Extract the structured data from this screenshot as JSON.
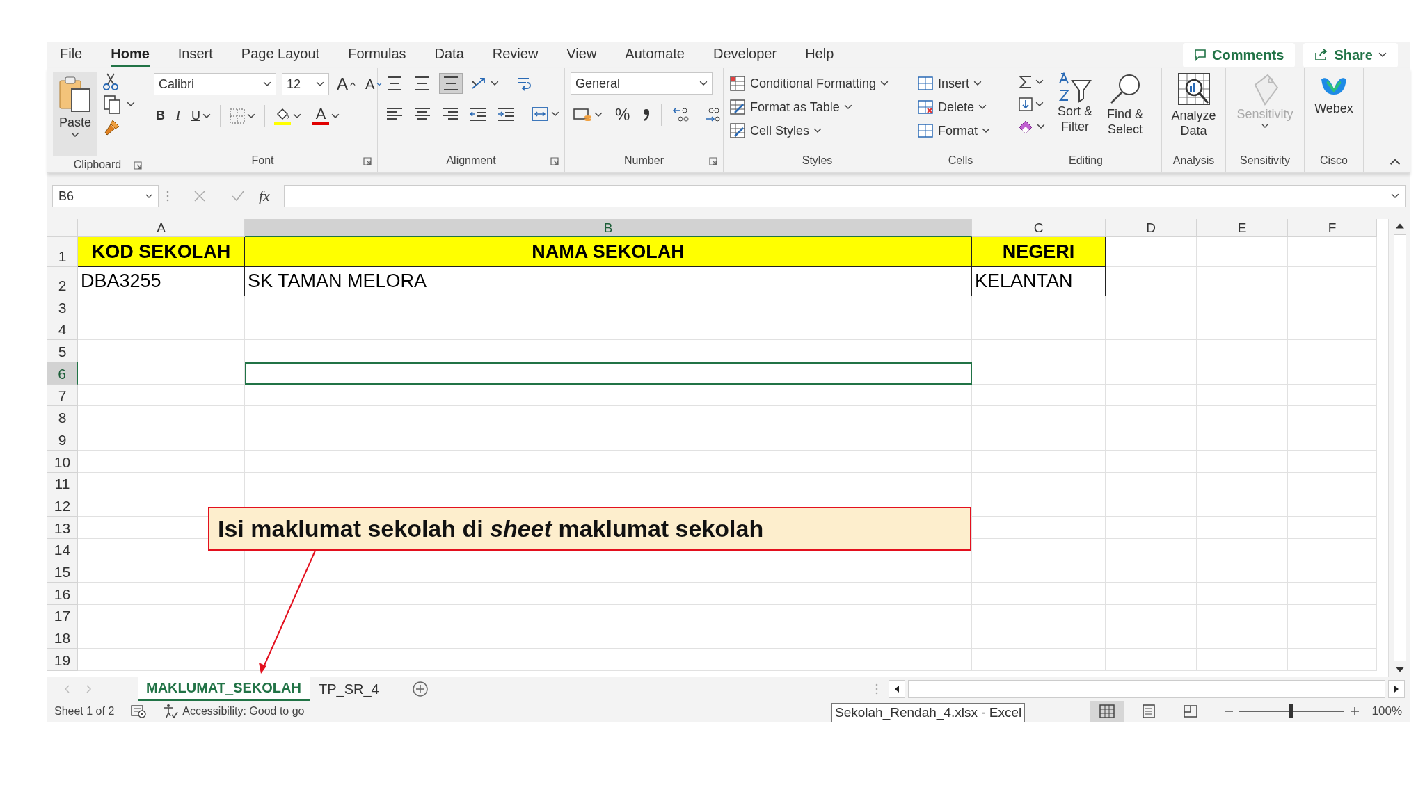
{
  "menu_tabs": [
    {
      "label": "File",
      "selected": false
    },
    {
      "label": "Home",
      "selected": true
    },
    {
      "label": "Insert",
      "selected": false
    },
    {
      "label": "Page Layout",
      "selected": false
    },
    {
      "label": "Formulas",
      "selected": false
    },
    {
      "label": "Data",
      "selected": false
    },
    {
      "label": "Review",
      "selected": false
    },
    {
      "label": "View",
      "selected": false
    },
    {
      "label": "Automate",
      "selected": false
    },
    {
      "label": "Developer",
      "selected": false
    },
    {
      "label": "Help",
      "selected": false
    }
  ],
  "comments_button": "Comments",
  "share_button": "Share",
  "ribbon": {
    "groups": [
      {
        "kind": "clipboard",
        "label": "Clipboard",
        "paste": "Paste"
      },
      {
        "kind": "font",
        "label": "Font",
        "font_name": "Calibri",
        "font_size": "12",
        "grow": "A",
        "shrink": "A",
        "bold": "B",
        "italic": "I",
        "underline": "U",
        "font_color": "A"
      },
      {
        "kind": "alignment",
        "label": "Alignment"
      },
      {
        "kind": "number",
        "label": "Number",
        "format": "General",
        "percent": "%"
      },
      {
        "kind": "styles",
        "label": "Styles",
        "items": [
          "Conditional Formatting",
          "Format as Table",
          "Cell Styles"
        ]
      },
      {
        "kind": "cells",
        "label": "Cells",
        "items": [
          "Insert",
          "Delete",
          "Format"
        ]
      },
      {
        "kind": "editing",
        "label": "Editing",
        "buttons": [
          "Sort & Filter",
          "Find & Select"
        ]
      },
      {
        "kind": "analysis",
        "label": "Analysis",
        "button": "Analyze Data"
      },
      {
        "kind": "sensitivity",
        "label": "Sensitivity",
        "button": "Sensitivity",
        "disabled": true
      },
      {
        "kind": "cisco",
        "label": "Cisco",
        "button": "Webex"
      }
    ]
  },
  "formula_bar": {
    "name_box": "B6",
    "fx": "fx"
  },
  "sheet": {
    "columns": [
      {
        "label": "A",
        "selected": false
      },
      {
        "label": "B",
        "selected": true
      },
      {
        "label": "C",
        "selected": false
      },
      {
        "label": "D",
        "selected": false
      },
      {
        "label": "E",
        "selected": false
      },
      {
        "label": "F",
        "selected": false
      }
    ],
    "rows": [
      {
        "number": "1",
        "selected": false,
        "kind": "header",
        "cells": [
          "KOD SEKOLAH",
          "NAMA SEKOLAH",
          "NEGERI"
        ]
      },
      {
        "number": "2",
        "selected": false,
        "kind": "data",
        "cells": [
          "DBA3255",
          "SK TAMAN MELORA",
          "KELANTAN"
        ]
      },
      {
        "number": "3",
        "selected": false
      },
      {
        "number": "4",
        "selected": false
      },
      {
        "number": "5",
        "selected": false
      },
      {
        "number": "6",
        "selected": true
      },
      {
        "number": "7",
        "selected": false
      },
      {
        "number": "8",
        "selected": false
      },
      {
        "number": "9",
        "selected": false
      },
      {
        "number": "10",
        "selected": false
      },
      {
        "number": "11",
        "selected": false
      },
      {
        "number": "12",
        "selected": false
      },
      {
        "number": "13",
        "selected": false
      },
      {
        "number": "14",
        "selected": false
      },
      {
        "number": "15",
        "selected": false
      },
      {
        "number": "16",
        "selected": false
      },
      {
        "number": "17",
        "selected": false
      },
      {
        "number": "18",
        "selected": false
      },
      {
        "number": "19",
        "selected": false
      }
    ]
  },
  "callout": {
    "text": "Isi maklumat sekolah di *sheet* maklumat sekolah"
  },
  "sheet_tabs": [
    {
      "label": "MAKLUMAT_SEKOLAH",
      "selected": true
    },
    {
      "label": "TP_SR_4",
      "selected": false
    }
  ],
  "status_bar": {
    "sheet_info": "Sheet 1 of 2",
    "accessibility": "Accessibility: Good to go",
    "tooltip": "Sekolah_Rendah_4.xlsx - Excel",
    "views": [
      {
        "kind": "normal",
        "selected": true
      },
      {
        "kind": "page_layout",
        "selected": false
      },
      {
        "kind": "page_break",
        "selected": false
      }
    ],
    "zoom": {
      "level": 0.5
    },
    "zoom_text": "100%"
  }
}
